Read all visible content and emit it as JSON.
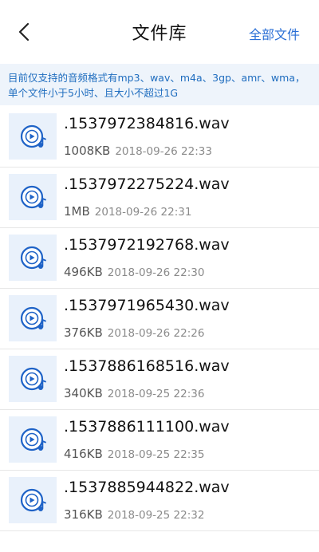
{
  "header": {
    "title": "文件库",
    "right_action": "全部文件"
  },
  "notice": {
    "text": "目前仅支持的音频格式有mp3、wav、m4a、3gp、amr、wma，单个文件小于5小时、且大小不超过1G"
  },
  "files": [
    {
      "name": ".1537972384816.wav",
      "size": "1008KB",
      "date": "2018-09-26 22:33"
    },
    {
      "name": ".1537972275224.wav",
      "size": "1MB",
      "date": "2018-09-26 22:31"
    },
    {
      "name": ".1537972192768.wav",
      "size": "496KB",
      "date": "2018-09-26 22:30"
    },
    {
      "name": ".1537971965430.wav",
      "size": "376KB",
      "date": "2018-09-26 22:26"
    },
    {
      "name": ".1537886168516.wav",
      "size": "340KB",
      "date": "2018-09-25 22:36"
    },
    {
      "name": ".1537886111100.wav",
      "size": "416KB",
      "date": "2018-09-25 22:35"
    },
    {
      "name": ".1537885944822.wav",
      "size": "316KB",
      "date": "2018-09-25 22:32"
    }
  ],
  "colors": {
    "accent": "#2a6fd6",
    "notice_bg": "#eef4fb",
    "thumb_bg": "#e9f1fb"
  },
  "icons": {
    "back": "chevron-left-icon",
    "file": "audio-file-icon"
  }
}
